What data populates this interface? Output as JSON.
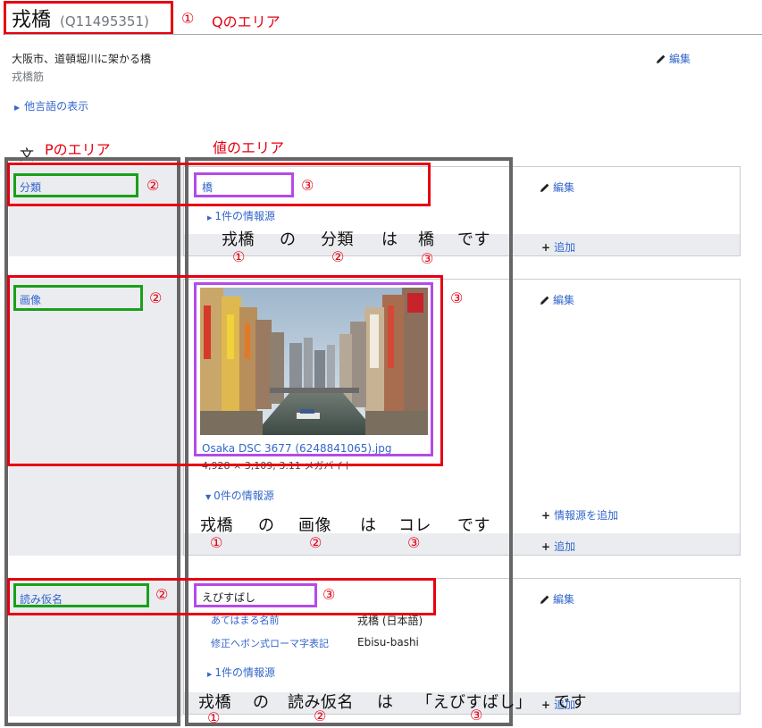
{
  "item": {
    "label": "戎橋",
    "qid": "(Q11495351)",
    "description": "大阪市、道頓堀川に架かる橋",
    "alias": "戎橋筋",
    "other_langs": "他言語の表示",
    "edit": "編集"
  },
  "annotations": {
    "n1": "①",
    "n2": "②",
    "n3": "③",
    "q_area": "Qのエリア",
    "p_area": "Pのエリア",
    "value_area": "値のエリア",
    "bunsho": "文",
    "s1": [
      "戎橋",
      "の",
      "分類",
      "は",
      "橋",
      "です"
    ],
    "s2": [
      "戎橋",
      "の",
      "画像",
      "は",
      "コレ",
      "です"
    ],
    "s3": [
      "戎橋",
      "の",
      "読み仮名",
      "は",
      "「えびすばし」",
      "です"
    ]
  },
  "statements": [
    {
      "property": "分類",
      "value": "橋",
      "references": "1件の情報源",
      "edit": "編集",
      "add": "追加"
    },
    {
      "property": "画像",
      "file_name": "Osaka DSC 3677 (6248841065).jpg",
      "file_meta": "4,928 × 3,109; 3.11 メガバイト",
      "references": "0件の情報源",
      "edit": "編集",
      "add_reference": "情報源を追加",
      "add": "追加"
    },
    {
      "property": "読み仮名",
      "value": "えびすばし",
      "qualifiers": [
        {
          "name": "あてはまる名前",
          "value": "戎橋 (日本語)"
        },
        {
          "name": "修正ヘボン式ローマ字表記",
          "value": "Ebisu-bashi"
        }
      ],
      "references": "1件の情報源",
      "edit": "編集",
      "add": "追加"
    }
  ],
  "colors": {
    "red": "#e60012",
    "green": "#1aa01a",
    "purple": "#b44be8",
    "gray": "#666666",
    "link": "#3366cc"
  }
}
